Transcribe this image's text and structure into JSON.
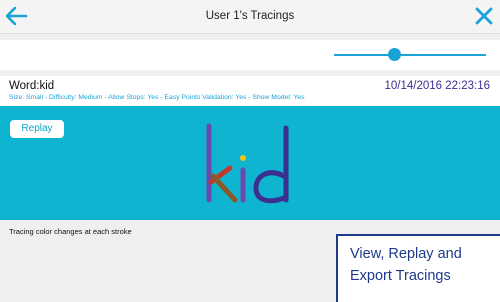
{
  "header": {
    "title": "User 1's Tracings",
    "back_icon": "arrow-left-icon",
    "close_icon": "close-icon"
  },
  "slider": {
    "value": 0.4
  },
  "tracing": {
    "word_label": "Word:kid",
    "timestamp": "10/14/2016 22:23:16",
    "details": "Size: Small - Difficulty: Medium - Allow Stops: Yes - Easy Points Validation: Yes - Show Model: Yes",
    "replay_label": "Replay",
    "drawn_word": "kid",
    "stroke_colors": [
      "#6a4ab0",
      "#c0392b",
      "#8b5a2b",
      "#6a4ab0",
      "#f1c40f",
      "#3b2f8f"
    ]
  },
  "note": "Tracing color changes at each stroke",
  "promo": {
    "line1": "View, Replay and",
    "line2": "Export Tracings"
  },
  "colors": {
    "accent": "#1aa3d4",
    "canvas": "#0fb5d0",
    "promo_text": "#1e3a8a"
  }
}
